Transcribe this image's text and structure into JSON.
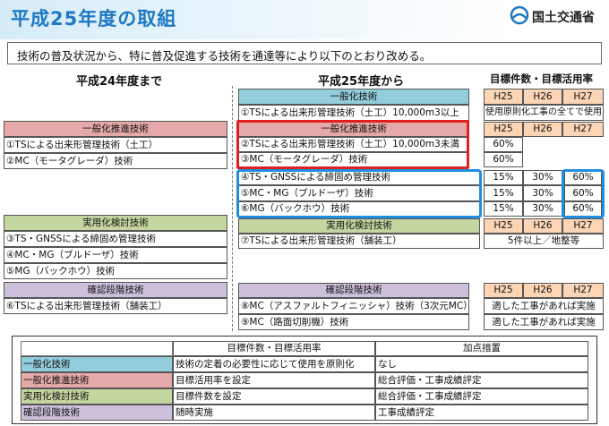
{
  "header": {
    "title": "平成25年度の取組",
    "ministry": "国土交通省"
  },
  "intro_text": "技術の普及状況から、特に普及促進する技術を通達等により以下のとおり改める。",
  "columns": {
    "left_title": "平成24年度まで",
    "right_title": "平成25年度から",
    "target_title": "目標件数・目標活用率"
  },
  "left": {
    "promo_header": "一般化推進技術",
    "promo_items": [
      "①TSによる出来形管理技術（土工）",
      "②MC（モータグレーダ）技術"
    ],
    "practical_header": "実用化検討技術",
    "practical_items": [
      "③TS・GNSSによる締固め管理技術",
      "④MC・MG（ブルドーザ）技術",
      "⑤MG（バックホウ）技術"
    ],
    "confirm_header": "確認段階技術",
    "confirm_items": [
      "⑥TSによる出来形管理技術（舗装工）"
    ]
  },
  "right": {
    "general_header": "一般化技術",
    "general_item": "①TSによる出来形管理技術（土工）10,000m3以上",
    "general_note": "使用原則化工事の全てで使用",
    "promo_header": "一般化推進技術",
    "promo_items": [
      "②TSによる出来形管理技術（土工）10,000m3未満",
      "③MC（モータグレーダ）技術"
    ],
    "promo_rates": [
      "60%",
      "60%"
    ],
    "other_items": [
      "④TS・GNSSによる締固め管理技術",
      "⑤MC・MG（ブルドーザ）技術",
      "⑥MG（バックホウ）技術"
    ],
    "other_rates": [
      [
        "15%",
        "30%",
        "60%"
      ],
      [
        "15%",
        "30%",
        "60%"
      ],
      [
        "15%",
        "30%",
        "60%"
      ]
    ],
    "practical_header": "実用化検討技術",
    "practical_item": "⑦TSによる出来形管理技術（舗装工）",
    "practical_note": "5件以上／地整等",
    "confirm_header": "確認段階技術",
    "confirm_items": [
      "⑧MC（アスファルトフィニッシャ）技術（3次元MC）",
      "⑨MC（路面切削機）技術"
    ],
    "confirm_notes": [
      "適した工事があれば実施",
      "適した工事があれば実施"
    ]
  },
  "years": [
    "H25",
    "H26",
    "H27"
  ],
  "legend": {
    "col_target": "目標件数・目標活用率",
    "col_extra": "加点措置",
    "rows": [
      {
        "name": "一般化技術",
        "target": "技術の定着の必要性に応じて使用を原則化",
        "extra": "なし"
      },
      {
        "name": "一般化推進技術",
        "target": "目標活用率を設定",
        "extra": "総合評価・工事成績評定"
      },
      {
        "name": "実用化検討技術",
        "target": "目標件数を設定",
        "extra": "総合評価・工事成績評定"
      },
      {
        "name": "確認段階技術",
        "target": "随時実施",
        "extra": "工事成績評定"
      }
    ]
  },
  "colors": {
    "title_blue": "#1f78c1",
    "pink": "#e6a9a9",
    "green": "#c4d6a0",
    "purple": "#ccc0da",
    "blue": "#92cddc",
    "year_header": "#fbd5b5",
    "highlight_red": "#e02020",
    "highlight_blue": "#1f8ee0"
  }
}
